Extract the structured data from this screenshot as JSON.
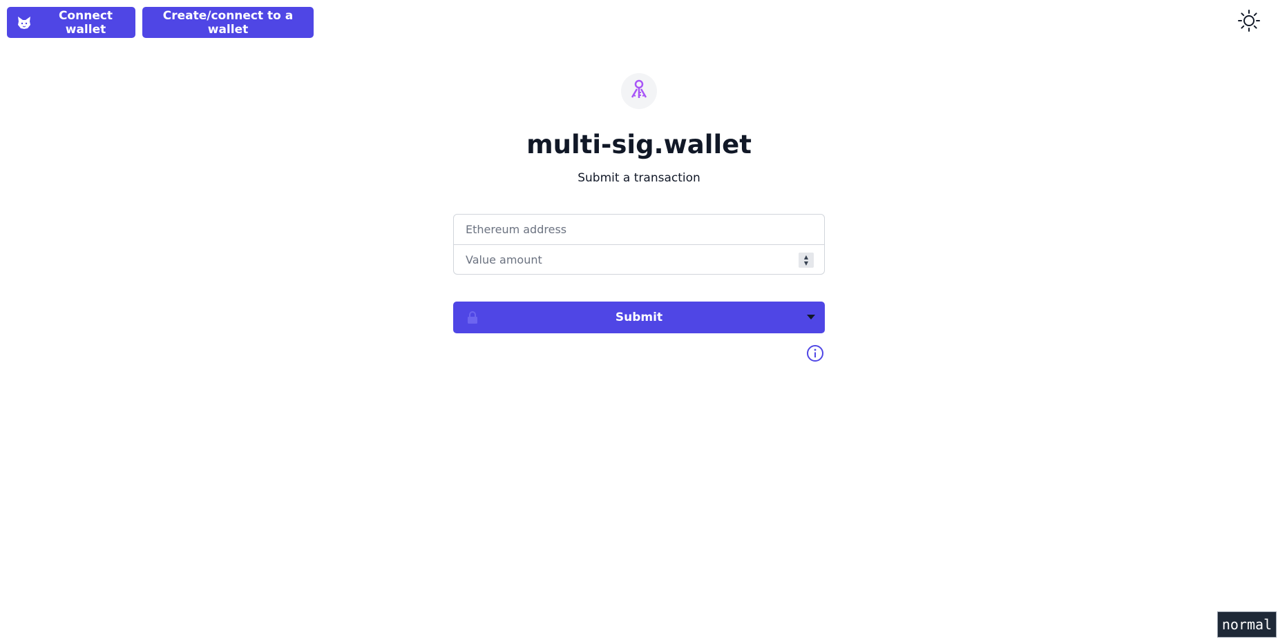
{
  "header": {
    "connect_wallet_label": "Connect wallet",
    "connect_wallet_icon": "metamask-fox-icon",
    "create_connect_label": "Create/connect to a wallet",
    "theme_toggle_icon": "sun-icon"
  },
  "hero": {
    "logo_icon": "keys-icon",
    "title": "multi-sig.wallet",
    "subtitle": "Submit a transaction"
  },
  "form": {
    "address_placeholder": "Ethereum address",
    "address_value": "",
    "amount_placeholder": "Value amount",
    "amount_value": ""
  },
  "submit": {
    "label": "Submit",
    "lock_icon": "lock-icon",
    "caret_icon": "caret-down-icon",
    "info_icon": "info-icon"
  },
  "status": {
    "mode": "normal"
  },
  "colors": {
    "accent": "#4f46e5",
    "logo_accent": "#a855f7",
    "text": "#111827"
  }
}
